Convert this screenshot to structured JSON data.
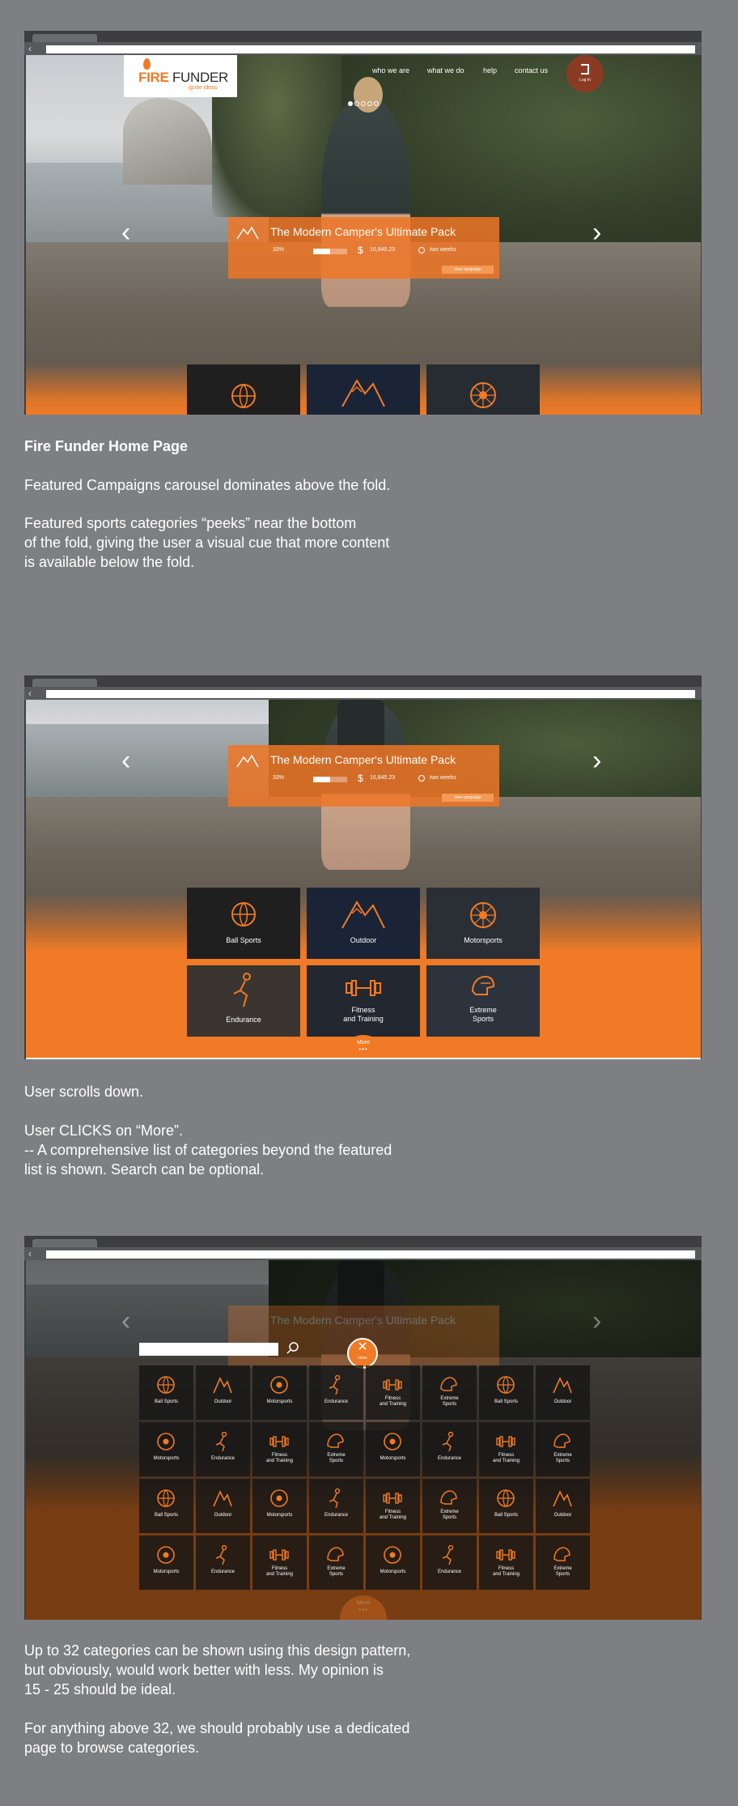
{
  "browser": {
    "back_glyph": "‹"
  },
  "site": {
    "logo_fire": "FIRE",
    "logo_funder": "FUNDER",
    "logo_tagline": "ignite ideas",
    "nav": [
      "who we are",
      "what we do",
      "help",
      "contact us"
    ],
    "login_label": "Log In"
  },
  "campaign": {
    "title": "The Modern Camper's Ultimate Pack",
    "funded": "33%",
    "funded_fraction": 0.5,
    "amount": "16,845.23",
    "time_left": "two weeks",
    "cta": "view campaign"
  },
  "featured_categories": [
    {
      "label": "Ball Sports",
      "icon": "basketball-icon"
    },
    {
      "label": "Outdoor",
      "icon": "mountain-icon"
    },
    {
      "label": "Motorsports",
      "icon": "wheel-icon"
    },
    {
      "label": "Endurance",
      "icon": "cyclist-icon"
    },
    {
      "label": "Fitness\nand Training",
      "icon": "dumbbell-icon"
    },
    {
      "label": "Extreme\nSports",
      "icon": "helmet-icon"
    }
  ],
  "more_button": {
    "label": "More",
    "dots": "•••"
  },
  "grid_close": {
    "glyph": "✕",
    "label": "close"
  },
  "grid_rows": [
    [
      "Ball Sports",
      "Outdoor",
      "Motorsports",
      "Endurance",
      "Fitness\nand Training",
      "Extreme\nSports",
      "Ball Sports",
      "Outdoor"
    ],
    [
      "Motorsports",
      "Endurance",
      "Fitness\nand Training",
      "Extreme\nSports",
      "Motorsports",
      "Endurance",
      "Fitness\nand Training",
      "Extreme\nSports"
    ],
    [
      "Ball Sports",
      "Outdoor",
      "Motorsports",
      "Endurance",
      "Fitness\nand Training",
      "Extreme\nSports",
      "Ball Sports",
      "Outdoor"
    ],
    [
      "Motorsports",
      "Endurance",
      "Fitness\nand Training",
      "Extreme\nSports",
      "Motorsports",
      "Endurance",
      "Fitness\nand Training",
      "Extreme\nSports"
    ]
  ],
  "notes": {
    "s1_title": "Fire Funder Home Page",
    "s1_p1": "Featured Campaigns carousel dominates above the fold.",
    "s1_p2": "Featured sports categories “peeks” near the bottom\nof the fold, giving the user a visual cue that more content\nis available below the fold.",
    "s2_p1": "User scrolls down.",
    "s2_p2": "User CLICKS on “More”.\n-- A comprehensive list of categories beyond the featured\nlist is shown. Search can be optional.",
    "s3_p1": "Up to 32 categories can be shown using this design pattern,\nbut obviously, would work better with less. My opinion is\n15 - 25 should be ideal.",
    "s3_p2": "For anything above 32, we should probably use a dedicated\npage to browse categories."
  },
  "colors": {
    "accent": "#f07a25",
    "page_bg": "#7e7f83",
    "tile_bg": "#1f1f1f"
  }
}
